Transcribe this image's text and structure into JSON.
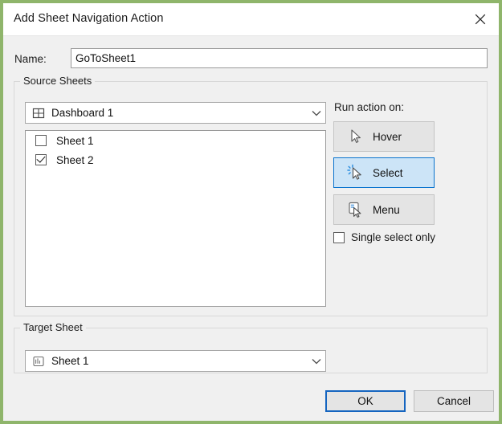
{
  "window": {
    "title": "Add Sheet Navigation Action",
    "close_icon": "close-x-icon"
  },
  "name_field": {
    "label": "Name:",
    "value": "GoToSheet1",
    "placeholder": ""
  },
  "source_sheets": {
    "legend": "Source Sheets",
    "dropdown": {
      "icon": "dashboard-grid-icon",
      "value": "Dashboard 1",
      "arrow_icon": "chevron-down-icon"
    },
    "sheets": [
      {
        "label": "Sheet 1",
        "checked": false
      },
      {
        "label": "Sheet 2",
        "checked": true
      }
    ]
  },
  "run_action": {
    "label": "Run action on:",
    "buttons": [
      {
        "label": "Hover",
        "icon": "cursor-arrow-icon",
        "selected": false
      },
      {
        "label": "Select",
        "icon": "cursor-click-icon",
        "selected": true
      },
      {
        "label": "Menu",
        "icon": "cursor-menu-icon",
        "selected": false
      }
    ],
    "single_select": {
      "label": "Single select only",
      "checked": false
    }
  },
  "target_sheet": {
    "legend": "Target Sheet",
    "dropdown": {
      "icon": "worksheet-icon",
      "value": "Sheet 1",
      "arrow_icon": "chevron-down-icon"
    }
  },
  "footer": {
    "ok_label": "OK",
    "cancel_label": "Cancel"
  },
  "colors": {
    "capture_border": "#8fb56b",
    "dialog_background": "#f0f0f0",
    "accent_selected": "#0a74cf",
    "accent_selected_fill": "#cce4f7",
    "default_button_focus": "#1565c0"
  }
}
